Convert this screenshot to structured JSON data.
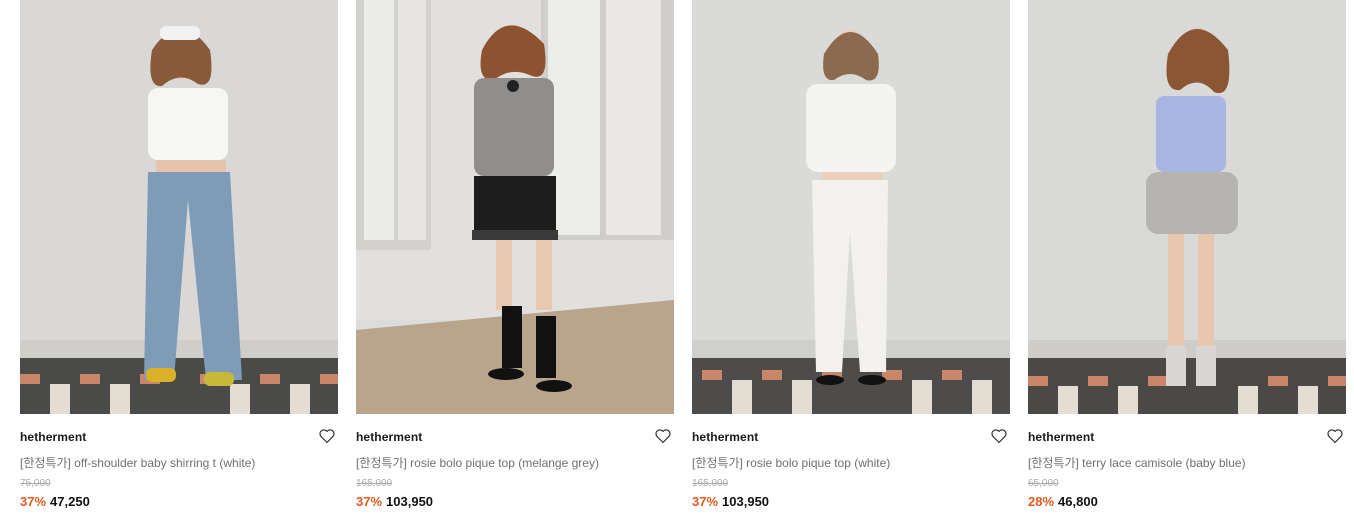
{
  "colors": {
    "discount": "#e2591e",
    "brand_text": "#1a1a1a",
    "name_text": "#6f6f6f",
    "original_price": "#aaaaaa"
  },
  "products": [
    {
      "brand": "hetherment",
      "name": "[한정특가] off-shoulder baby shirring t (white)",
      "original_price": "75,000",
      "discount": "37%",
      "price": "47,250",
      "icon": "heart-outline-icon"
    },
    {
      "brand": "hetherment",
      "name": "[한정특가] rosie bolo pique top (melange grey)",
      "original_price": "165,000",
      "discount": "37%",
      "price": "103,950",
      "icon": "heart-outline-icon"
    },
    {
      "brand": "hetherment",
      "name": "[한정특가] rosie bolo pique top (white)",
      "original_price": "165,000",
      "discount": "37%",
      "price": "103,950",
      "icon": "heart-outline-icon"
    },
    {
      "brand": "hetherment",
      "name": "[한정특가] terry lace camisole (baby blue)",
      "original_price": "65,000",
      "discount": "28%",
      "price": "46,800",
      "icon": "heart-outline-icon"
    }
  ]
}
